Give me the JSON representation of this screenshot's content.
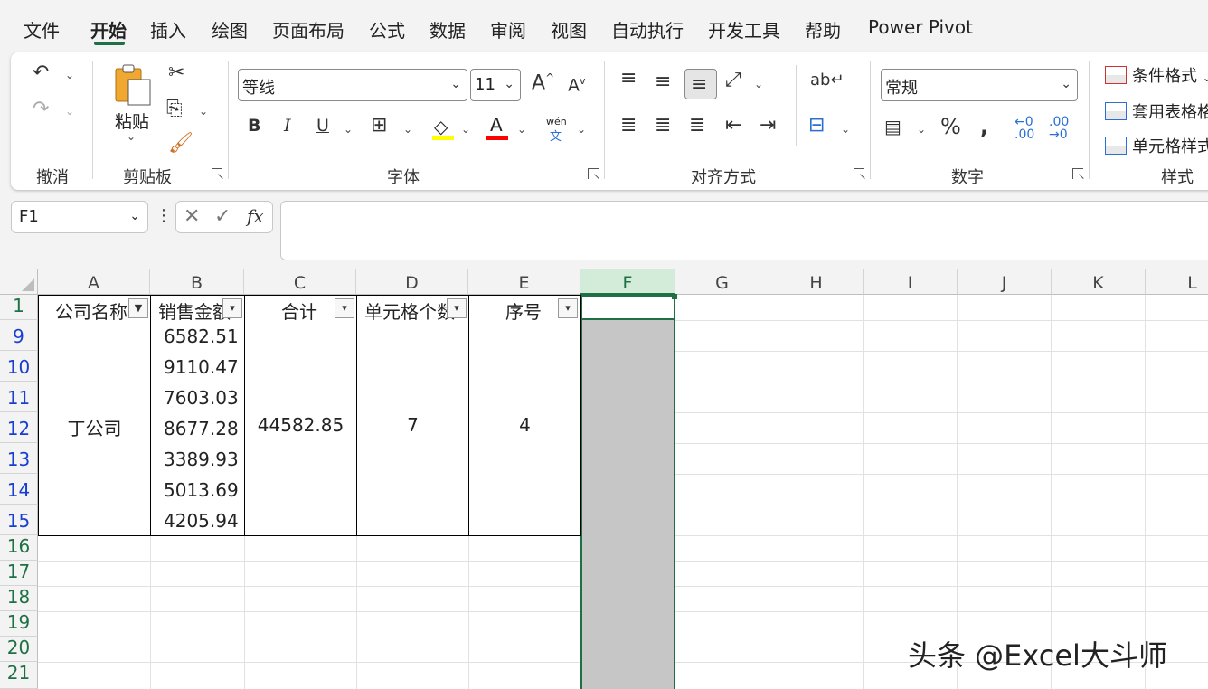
{
  "menu": {
    "tabs": [
      "文件",
      "开始",
      "插入",
      "绘图",
      "页面布局",
      "公式",
      "数据",
      "审阅",
      "视图",
      "自动执行",
      "开发工具",
      "帮助",
      "Power Pivot"
    ],
    "active_index": 1
  },
  "ribbon": {
    "groups": {
      "undo": "撤消",
      "clipboard": "剪贴板",
      "font": "字体",
      "alignment": "对齐方式",
      "number": "数字",
      "styles": "样式"
    },
    "clipboard": {
      "paste_label": "粘贴"
    },
    "font": {
      "name": "等线",
      "size": "11",
      "bold": "B",
      "italic": "I",
      "underline": "U",
      "wen": "wén",
      "wen2": "文"
    },
    "number": {
      "format": "常规"
    },
    "styles": {
      "conditional": "条件格式",
      "table": "套用表格格式",
      "cell": "单元格样式"
    },
    "colors": {
      "highlight": "#ffff00",
      "font_color": "#ff0000",
      "accent": "#1f7145"
    }
  },
  "formula_bar": {
    "name_box": "F1",
    "fx": "fx",
    "cancel": "✕",
    "confirm": "✓",
    "content": ""
  },
  "sheet": {
    "columns": [
      "A",
      "B",
      "C",
      "D",
      "E",
      "F",
      "G",
      "H",
      "I",
      "J",
      "K",
      "L"
    ],
    "selected_column": "F",
    "rows": [
      "1",
      "9",
      "10",
      "11",
      "12",
      "13",
      "14",
      "15",
      "16",
      "17",
      "18",
      "19",
      "20",
      "21"
    ],
    "headers": {
      "a": "公司名称",
      "b": "销售金额",
      "c": "合计",
      "d": "单元格个数",
      "e": "序号"
    },
    "company": "丁公司",
    "sales": [
      "6582.51",
      "9110.47",
      "7603.03",
      "8677.28",
      "3389.93",
      "5013.69",
      "4205.94"
    ],
    "total": "44582.85",
    "count": "7",
    "index": "4"
  },
  "watermark": "头条 @Excel大斗师"
}
